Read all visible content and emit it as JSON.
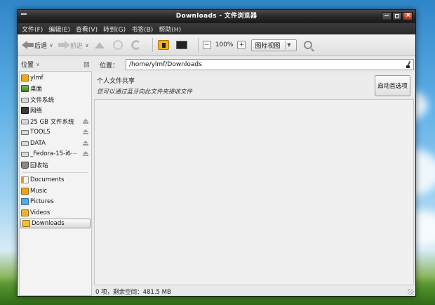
{
  "window": {
    "title": "Downloads - 文件浏览器"
  },
  "menu": [
    "文件(F)",
    "编辑(E)",
    "查看(V)",
    "转到(G)",
    "书签(B)",
    "帮助(H)"
  ],
  "toolbar": {
    "back_label": "后退",
    "forward_label": "前进",
    "zoom": "100%",
    "view_mode": "图标视图"
  },
  "sidebar": {
    "header": "位置",
    "items": [
      {
        "label": "ylmf",
        "icon": "home-folder-icon"
      },
      {
        "label": "桌面",
        "icon": "desktop-icon"
      },
      {
        "label": "文件系统",
        "icon": "drive-icon"
      },
      {
        "label": "网络",
        "icon": "network-icon"
      },
      {
        "label": "25 GB 文件系统",
        "icon": "drive-icon",
        "eject": true
      },
      {
        "label": "TOOLS",
        "icon": "drive-icon",
        "eject": true
      },
      {
        "label": "DATA",
        "icon": "drive-icon",
        "eject": true
      },
      {
        "label": "_Fedora-15-i6⋯",
        "icon": "drive-icon",
        "eject": true
      },
      {
        "label": "回收站",
        "icon": "trash-icon"
      },
      {
        "label": "Documents",
        "icon": "documents-icon"
      },
      {
        "label": "Music",
        "icon": "music-icon"
      },
      {
        "label": "Pictures",
        "icon": "pictures-icon"
      },
      {
        "label": "Videos",
        "icon": "videos-icon"
      },
      {
        "label": "Downloads",
        "icon": "downloads-icon",
        "active": true
      }
    ]
  },
  "location": {
    "label": "位置：",
    "path": "/home/ylmf/Downloads"
  },
  "share": {
    "title": "个人文件共享",
    "description": "您可以通过蓝牙向此文件夹接收文件",
    "button": "启动首选项"
  },
  "status": "0 项，剩余空间：481.5 MB"
}
